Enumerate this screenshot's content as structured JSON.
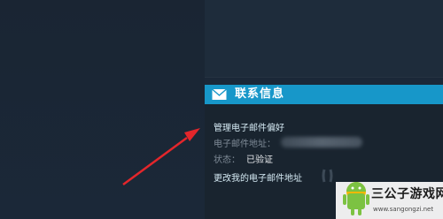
{
  "contact": {
    "title": "联系信息",
    "manage_prefs_link": "管理电子邮件偏好",
    "email_label": "电子邮件地址：",
    "email_value": "",
    "status_label": "状态：",
    "status_value": "已验证",
    "change_email_link": "更改我的电子邮件地址"
  },
  "colors": {
    "header": "#1797c9",
    "background": "#1b2838",
    "arrow": "#e3262b"
  },
  "icons": {
    "header": "mail-icon",
    "annotation": "red-arrow"
  },
  "watermark": {
    "title": "三公子游戏网",
    "url": "www.sangongzi.net"
  }
}
